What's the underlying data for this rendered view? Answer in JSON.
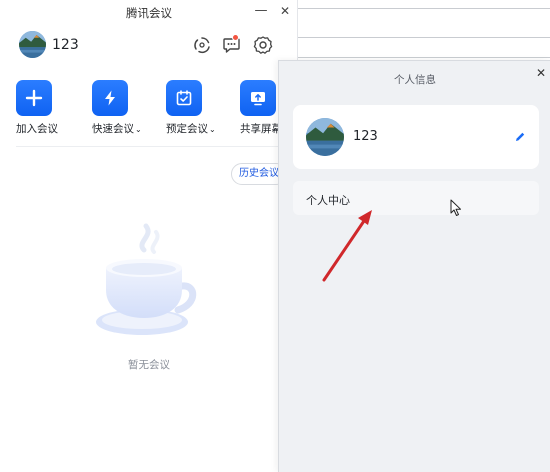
{
  "main_window": {
    "title": "腾讯会议",
    "user": {
      "name": "123"
    },
    "actions": [
      {
        "label": "加入会议"
      },
      {
        "label": "快速会议",
        "chevron": "⌄"
      },
      {
        "label": "预定会议",
        "chevron": "⌄"
      },
      {
        "label": "共享屏幕"
      }
    ],
    "history_label": "历史会议",
    "empty_text": "暂无会议",
    "icons": {
      "sync": "sync-icon",
      "message": "message-icon",
      "settings": "gear-icon",
      "join": "plus-icon",
      "quick": "lightning-icon",
      "schedule": "calendar-icon",
      "share": "screen-share-icon"
    },
    "accent_color": "#1a6cf6",
    "notification_dot_color": "#f25542"
  },
  "profile_panel": {
    "title": "个人信息",
    "user": {
      "name": "123"
    },
    "menu_item": "个人中心",
    "icons": {
      "edit": "pencil-icon",
      "close": "close-icon"
    }
  },
  "annotation": {
    "arrow_color": "#d0282b"
  }
}
